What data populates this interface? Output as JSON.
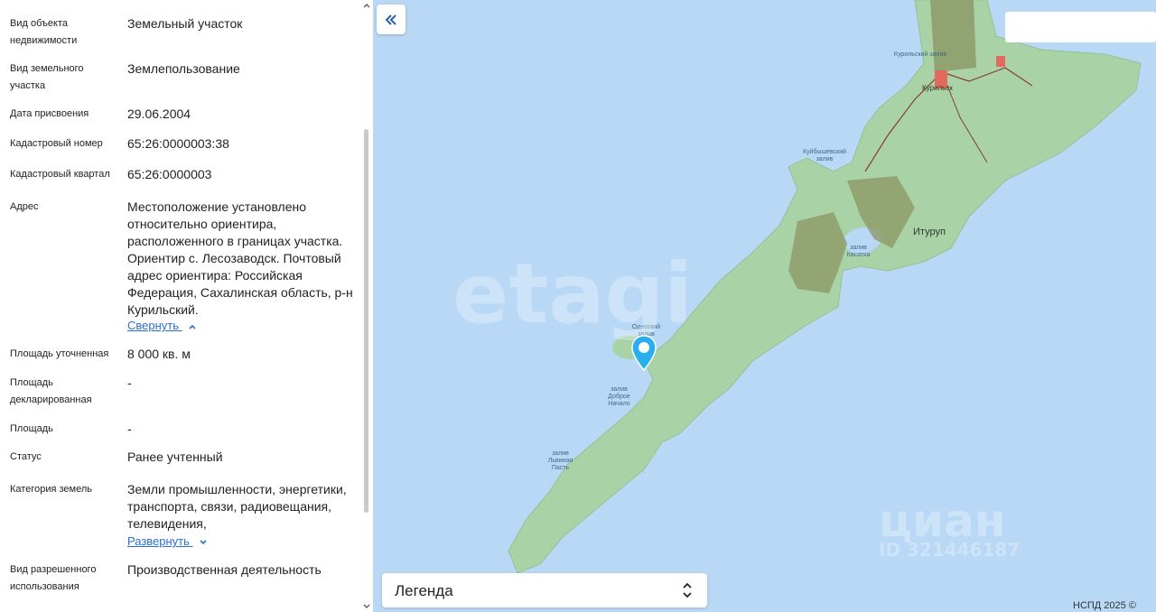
{
  "property": {
    "rows": [
      {
        "label": "Вид объекта недвижимости",
        "value": "Земельный участок"
      },
      {
        "label": "Вид земельного участка",
        "value": "Землепользование"
      },
      {
        "label": "Дата присвоения",
        "value": "29.06.2004"
      },
      {
        "label": "Кадастровый номер",
        "value": "65:26:0000003:38"
      },
      {
        "label": "Кадастровый квартал",
        "value": "65:26:0000003"
      },
      {
        "label": "Адрес",
        "value": "Местоположение установлено относительно ориентира, расположенного в границах участка. Ориентир с. Лесозаводск. Почтовый адрес ориентира: Российская Федерация, Сахалинская область, р-н Курильский."
      },
      {
        "label": "Площадь уточненная",
        "value": "8 000 кв. м"
      },
      {
        "label": "Площадь декларированная",
        "value": "-"
      },
      {
        "label": "Площадь",
        "value": "-"
      },
      {
        "label": "Статус",
        "value": "Ранее учтенный"
      },
      {
        "label": "Категория земель",
        "value": "Земли промышленности, энергетики, транспорта, связи, радиовещания, телевидения,"
      },
      {
        "label": "Вид разрешенного использования",
        "value": "Производственная деятельность"
      }
    ],
    "collapse_label": "Свернуть",
    "expand_label": "Развернуть"
  },
  "map": {
    "legend_label": "Легенда",
    "copyright": "НСПД 2025 ©",
    "labels": {
      "kurilsky_bay": "Курильский залив",
      "kurilsk": "Курильск",
      "kuybyshev_bay": "Куйбышевский залив",
      "iturup": "Итуруп",
      "kasatka_bay": "залив Касатка",
      "bay_top": "Одесский залив",
      "dobroe_nachalo": "залив Доброе Начало",
      "lvinaya_past": "залив Львиная Пасть"
    },
    "watermark_etagi": "etagi",
    "watermark_cian": "циан",
    "watermark_id": "ID 321446187"
  }
}
